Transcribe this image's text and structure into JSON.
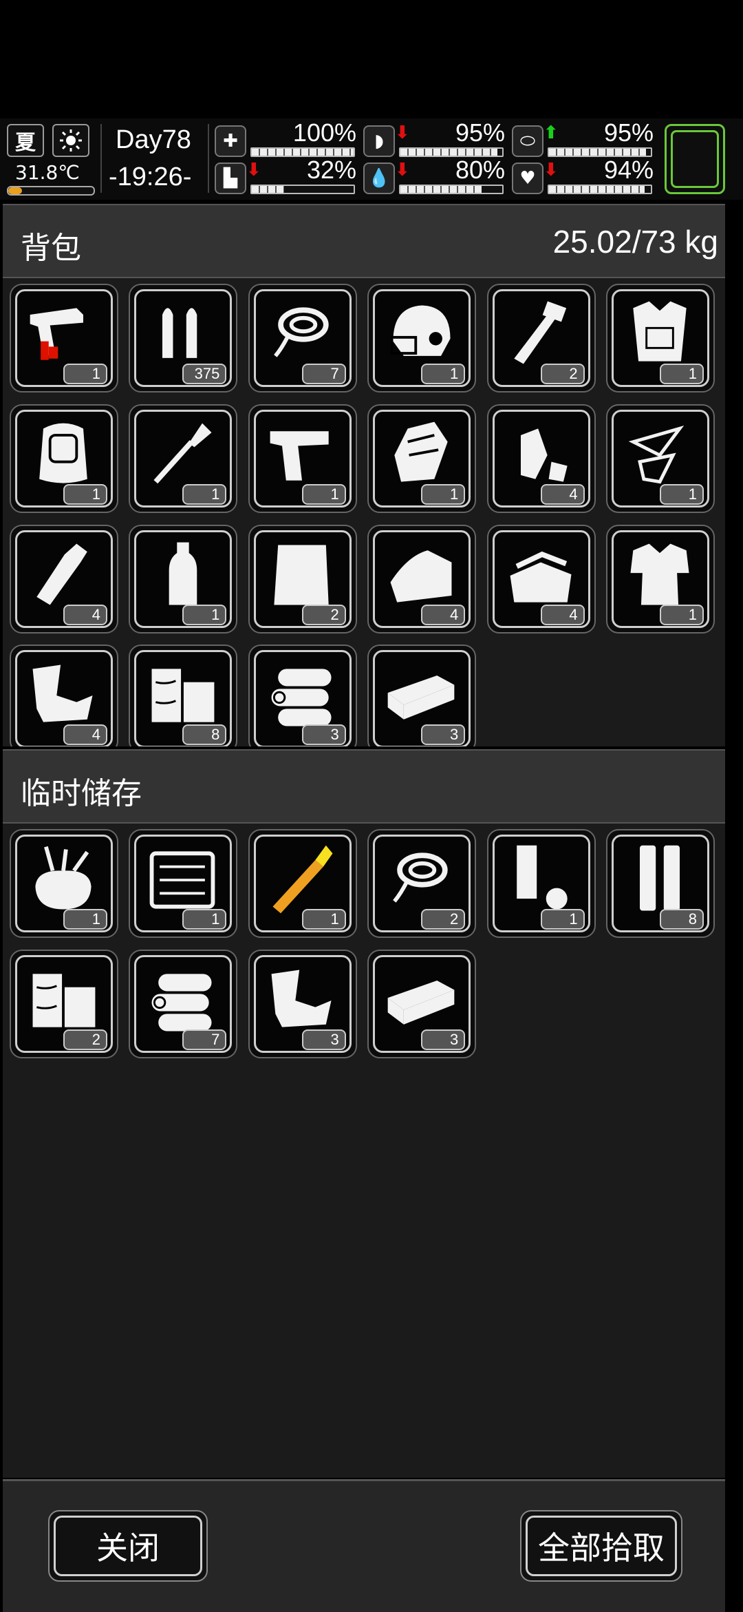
{
  "status": {
    "season": "夏",
    "weather_icon": "sun-icon",
    "temperature": "31.8℃",
    "day": "Day78",
    "time": "-19:26-",
    "stats": [
      {
        "name": "health",
        "icon": "medkit-icon",
        "value": "100%",
        "fill": 1.0,
        "trend": ""
      },
      {
        "name": "hunger",
        "icon": "stomach-icon",
        "value": "95%",
        "fill": 0.95,
        "trend": "down"
      },
      {
        "name": "energy",
        "icon": "pill-icon",
        "value": "95%",
        "fill": 0.95,
        "trend": "up"
      },
      {
        "name": "stamina",
        "icon": "leg-icon",
        "value": "32%",
        "fill": 0.32,
        "trend": "down"
      },
      {
        "name": "thirst",
        "icon": "water-drop-icon",
        "value": "80%",
        "fill": 0.8,
        "trend": "down"
      },
      {
        "name": "mood",
        "icon": "heart-icon",
        "value": "94%",
        "fill": 0.94,
        "trend": "down"
      }
    ],
    "colors": {
      "down": "#e01010",
      "up": "#18d018",
      "equip_border": "#6ac83a"
    }
  },
  "backpack": {
    "title": "背包",
    "weight": "25.02/73 kg",
    "items": [
      {
        "icon": "flare-gun-icon",
        "count": "1"
      },
      {
        "icon": "bullets-icon",
        "count": "375"
      },
      {
        "icon": "rope-icon",
        "count": "7"
      },
      {
        "icon": "helmet-icon",
        "count": "1"
      },
      {
        "icon": "machete-icon",
        "count": "2"
      },
      {
        "icon": "armor-vest-icon",
        "count": "1"
      },
      {
        "icon": "backpack-icon",
        "count": "1"
      },
      {
        "icon": "shovel-icon",
        "count": "1"
      },
      {
        "icon": "pistol-icon",
        "count": "1"
      },
      {
        "icon": "gloves-icon",
        "count": "1"
      },
      {
        "icon": "plastic-bottle-scrap-icon",
        "count": "4"
      },
      {
        "icon": "glass-shards-icon",
        "count": "1"
      },
      {
        "icon": "glass-bottle-icon",
        "count": "4"
      },
      {
        "icon": "water-bottle-icon",
        "count": "1"
      },
      {
        "icon": "cloth-sheet-icon",
        "count": "2"
      },
      {
        "icon": "towel-icon",
        "count": "4"
      },
      {
        "icon": "folded-cloth-icon",
        "count": "4"
      },
      {
        "icon": "torn-shirt-icon",
        "count": "1"
      },
      {
        "icon": "scrap-metal-icon",
        "count": "4"
      },
      {
        "icon": "wood-blocks-icon",
        "count": "8"
      },
      {
        "icon": "logs-icon",
        "count": "3"
      },
      {
        "icon": "wooden-plank-icon",
        "count": "3"
      }
    ]
  },
  "storage": {
    "title": "临时储存",
    "items": [
      {
        "icon": "tool-pouch-icon",
        "count": "1"
      },
      {
        "icon": "toolbox-icon",
        "count": "1"
      },
      {
        "icon": "fuel-tube-icon",
        "count": "1",
        "color": "#f0a020"
      },
      {
        "icon": "rope-icon",
        "count": "2"
      },
      {
        "icon": "metal-pipe-icon",
        "count": "1"
      },
      {
        "icon": "steel-tubes-icon",
        "count": "8"
      },
      {
        "icon": "wood-blocks-icon",
        "count": "2"
      },
      {
        "icon": "logs-icon",
        "count": "7"
      },
      {
        "icon": "scrap-metal-icon",
        "count": "3"
      },
      {
        "icon": "wooden-plank-icon",
        "count": "3"
      }
    ]
  },
  "buttons": {
    "close": "关闭",
    "take_all": "全部拾取"
  }
}
